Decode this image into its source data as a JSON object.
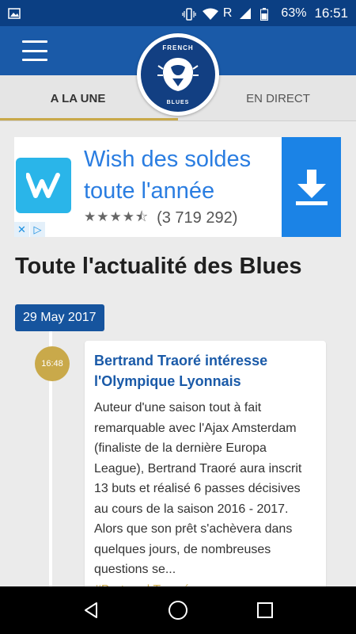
{
  "status_bar": {
    "signal_r": "R",
    "battery": "63%",
    "time": "16:51"
  },
  "app": {
    "logo_top": "FRENCH",
    "logo_bottom": "BLUES"
  },
  "tabs": [
    {
      "label": "A LA UNE"
    },
    {
      "label": "EN DIRECT"
    }
  ],
  "ad": {
    "title": "Wish des soldes toute l'année",
    "stars": "★★★★⯪",
    "rating_count": "(3 719 292)"
  },
  "section": {
    "title": "Toute l'actualité des Blues"
  },
  "feed": {
    "date": "29 May 2017",
    "items": [
      {
        "time": "16:48",
        "title": "Bertrand Traoré intéresse l'Olympique Lyonnais",
        "body": "Auteur d'une saison tout à fait remarquable avec l'Ajax Amsterdam (finaliste de la dernière Europa League), Bertrand Traoré aura inscrit 13 buts et réalisé 6 passes décisives au cours de la saison 2016 - 2017. Alors que son prêt s'achèvera dans quelques jours, de nombreuses questions se...",
        "tag": "#Bertrand Traoré"
      }
    ]
  }
}
